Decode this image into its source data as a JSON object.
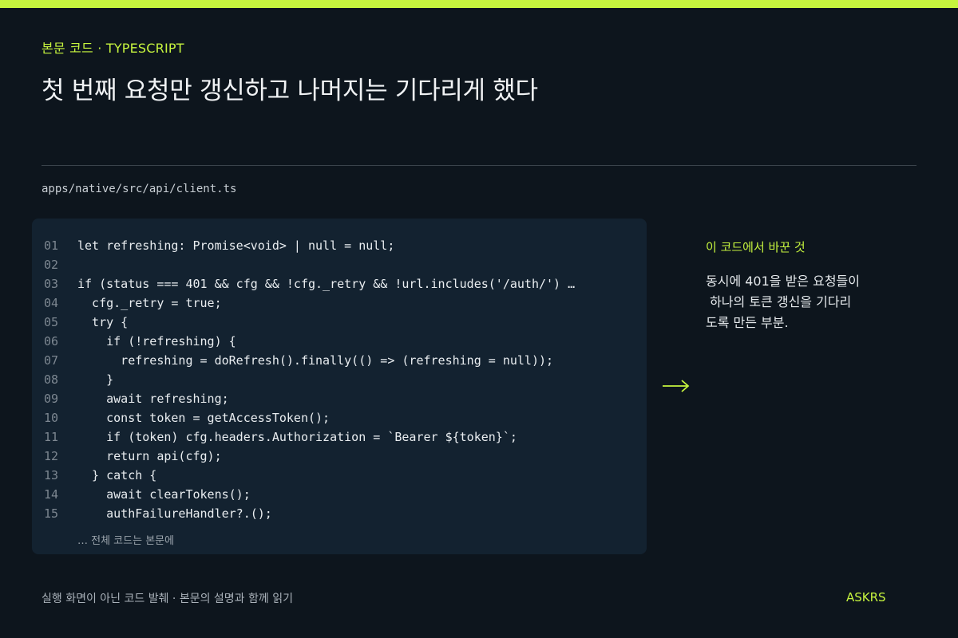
{
  "header": {
    "eyebrow": "본문 코드 · TYPESCRIPT",
    "title": "첫 번째 요청만 갱신하고 나머지는 기다리게 했다"
  },
  "file": {
    "path": "apps/native/src/api/client.ts"
  },
  "code": {
    "lines": [
      {
        "no": "01",
        "text": "let refreshing: Promise<void> | null = null;"
      },
      {
        "no": "02",
        "text": ""
      },
      {
        "no": "03",
        "text": "if (status === 401 && cfg && !cfg._retry && !url.includes('/auth/') …"
      },
      {
        "no": "04",
        "text": "  cfg._retry = true;"
      },
      {
        "no": "05",
        "text": "  try {"
      },
      {
        "no": "06",
        "text": "    if (!refreshing) {"
      },
      {
        "no": "07",
        "text": "      refreshing = doRefresh().finally(() => (refreshing = null));"
      },
      {
        "no": "08",
        "text": "    }"
      },
      {
        "no": "09",
        "text": "    await refreshing;"
      },
      {
        "no": "10",
        "text": "    const token = getAccessToken();"
      },
      {
        "no": "11",
        "text": "    if (token) cfg.headers.Authorization = `Bearer ${token}`;"
      },
      {
        "no": "12",
        "text": "    return api(cfg);"
      },
      {
        "no": "13",
        "text": "  } catch {"
      },
      {
        "no": "14",
        "text": "    await clearTokens();"
      },
      {
        "no": "15",
        "text": "    authFailureHandler?.();"
      }
    ],
    "footer": "… 전체 코드는 본문에"
  },
  "note": {
    "title": "이 코드에서 바꾼 것",
    "lines": [
      "동시에 401을 받은 요청들이",
      " 하나의 토큰 갱신을 기다리",
      "도록 만든 부분."
    ]
  },
  "footer": {
    "caption": "실행 화면이 아닌 코드 발췌 · 본문의 설명과 함께 읽기",
    "brand": "ASKRS"
  },
  "colors": {
    "accent": "#c6f43e",
    "background": "#0d151d",
    "code_panel": "#132230"
  },
  "icons": {
    "arrow": "right-arrow-icon"
  }
}
